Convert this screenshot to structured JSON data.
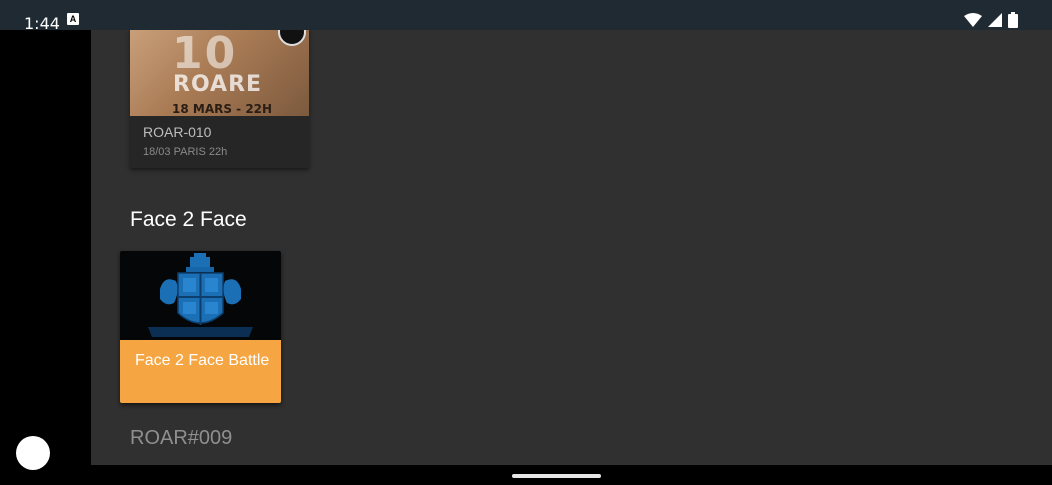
{
  "status_bar": {
    "time": "1:44",
    "notification_icon_letter": "A",
    "icons": [
      "wifi-icon",
      "cell-signal-icon",
      "battery-icon"
    ]
  },
  "sections": [
    {
      "cards": [
        {
          "image_text": {
            "number": "10",
            "word": "ROARE",
            "date": "18 MARS - 22H"
          },
          "title": "ROAR-010",
          "subtitle": "18/03 PARIS 22h"
        }
      ]
    },
    {
      "title": "Face 2 Face",
      "cards": [
        {
          "title": "Face 2 Face Battle",
          "accent_color": "#F5A542"
        }
      ]
    },
    {
      "title": "ROAR#009"
    }
  ],
  "colors": {
    "background": "#303030",
    "status_bar": "#1F2A33",
    "crest_blue": "#1B6FB5"
  }
}
